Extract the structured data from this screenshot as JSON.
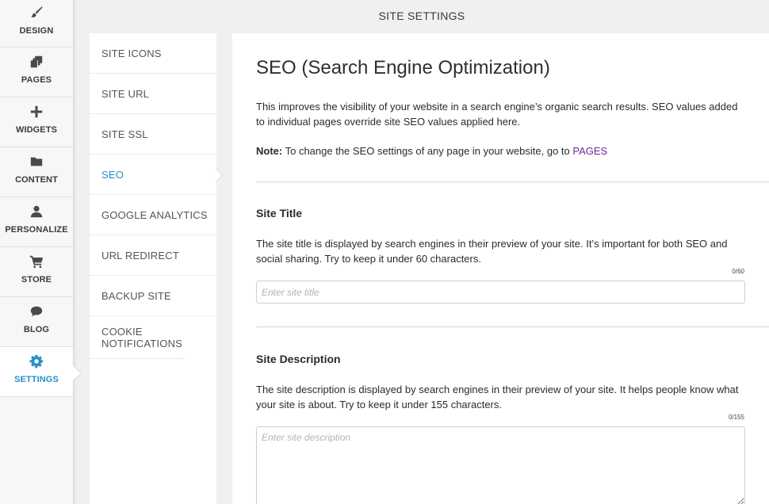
{
  "header": {
    "title": "SITE SETTINGS"
  },
  "rail": [
    {
      "label": "DESIGN",
      "icon": "paintbrush-icon"
    },
    {
      "label": "PAGES",
      "icon": "pages-icon"
    },
    {
      "label": "WIDGETS",
      "icon": "plus-icon"
    },
    {
      "label": "CONTENT",
      "icon": "folder-icon"
    },
    {
      "label": "PERSONALIZE",
      "icon": "person-icon"
    },
    {
      "label": "STORE",
      "icon": "cart-icon"
    },
    {
      "label": "BLOG",
      "icon": "speech-bubble-icon"
    },
    {
      "label": "SETTINGS",
      "icon": "gear-icon",
      "active": true
    }
  ],
  "submenu": [
    {
      "label": "SITE ICONS"
    },
    {
      "label": "SITE URL"
    },
    {
      "label": "SITE SSL"
    },
    {
      "label": "SEO",
      "active": true
    },
    {
      "label": "GOOGLE ANALYTICS"
    },
    {
      "label": "URL REDIRECT"
    },
    {
      "label": "BACKUP SITE"
    },
    {
      "label": "COOKIE NOTIFICATIONS"
    }
  ],
  "main": {
    "title": "SEO (Search Engine Optimization)",
    "intro": "This improves the visibility of your website in a search engine’s organic search results. SEO values added to individual pages override site SEO values applied here.",
    "note_label": "Note:",
    "note_text": " To change the SEO settings of any page in your website, go to ",
    "note_link": "PAGES",
    "site_title": {
      "heading": "Site Title",
      "description": "The site title is displayed by search engines in their preview of your site. It’s important for both SEO and social sharing. Try to keep it under 60 characters.",
      "counter": "0/60",
      "value": "",
      "placeholder": "Enter site title"
    },
    "site_description": {
      "heading": "Site Description",
      "description": "The site description is displayed by search engines in their preview of your site. It helps people know what your site is about. Try to keep it under 155 characters.",
      "counter": "0/155",
      "value": "",
      "placeholder": "Enter site description"
    }
  },
  "colors": {
    "accent": "#2a8fc8",
    "link": "#6b2c91"
  }
}
